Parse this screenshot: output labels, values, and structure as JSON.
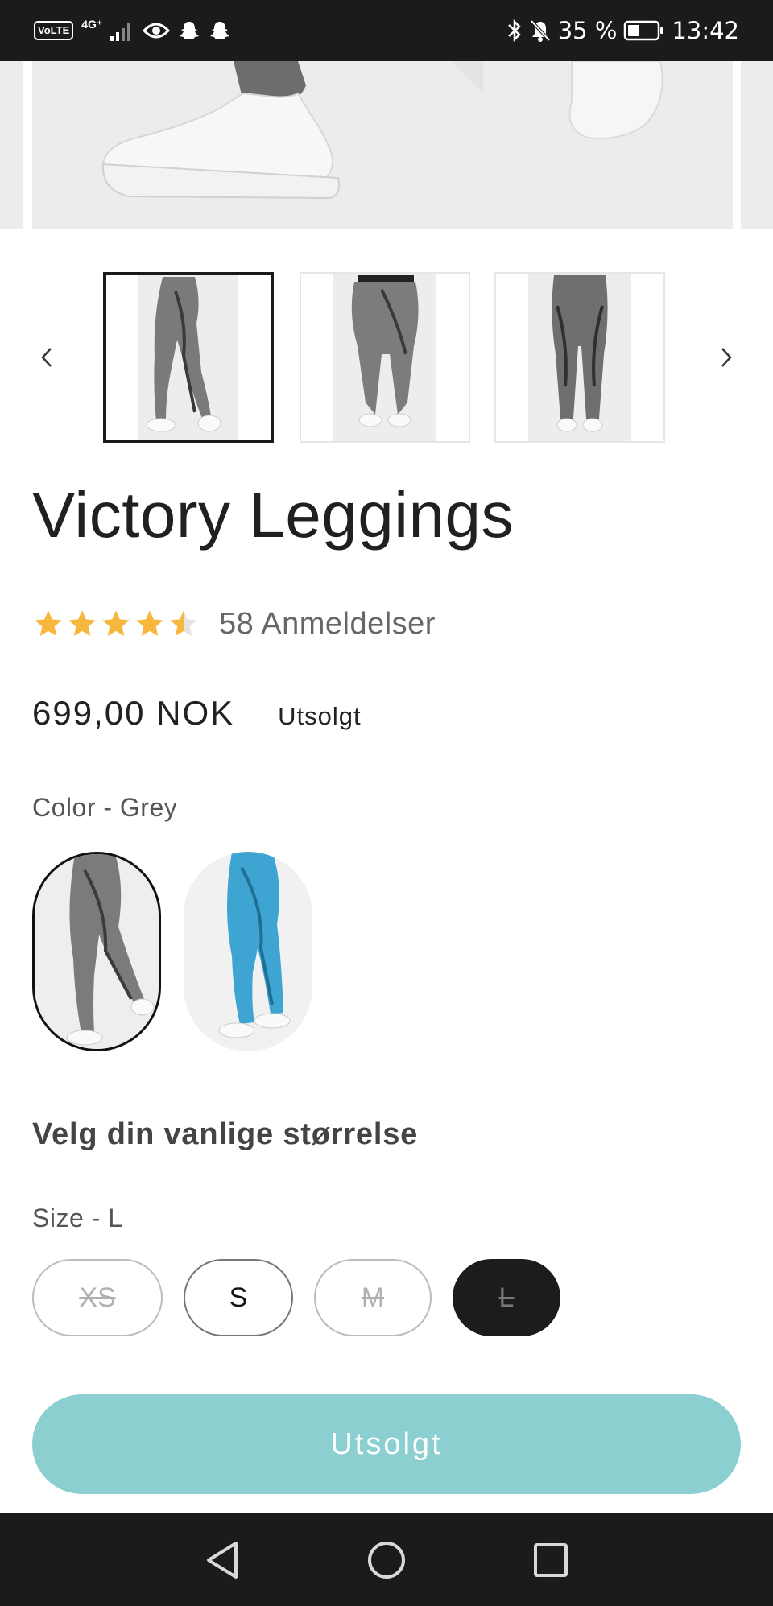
{
  "status_bar": {
    "volte": "VoLTE",
    "network": "4G⁺",
    "battery_percent": "35 %",
    "time": "13:42",
    "icons": [
      "signal-icon",
      "eye-icon",
      "snapchat-icon",
      "snapchat-icon",
      "bluetooth-icon",
      "bell-off-icon",
      "battery-icon"
    ]
  },
  "product": {
    "title": "Victory Leggings",
    "rating_value": 4.5,
    "rating_max": 5,
    "review_count": "58 Anmeldelser",
    "price": "699,00 NOK",
    "availability_badge": "Utsolgt"
  },
  "color": {
    "label": "Color - Grey",
    "options": [
      {
        "name": "Grey",
        "selected": true
      },
      {
        "name": "Blue",
        "selected": false
      }
    ]
  },
  "size": {
    "heading": "Velg din vanlige størrelse",
    "label": "Size - L",
    "options": [
      {
        "label": "XS",
        "available": false,
        "selected": false
      },
      {
        "label": "S",
        "available": true,
        "selected": false
      },
      {
        "label": "M",
        "available": false,
        "selected": false
      },
      {
        "label": "L",
        "available": false,
        "selected": true
      }
    ]
  },
  "add_button": {
    "label": "Utsolgt"
  },
  "colors": {
    "star": "#f6b73c",
    "sold_out_button": "#8ccfd1",
    "selected_size": "#1c1c1c"
  }
}
